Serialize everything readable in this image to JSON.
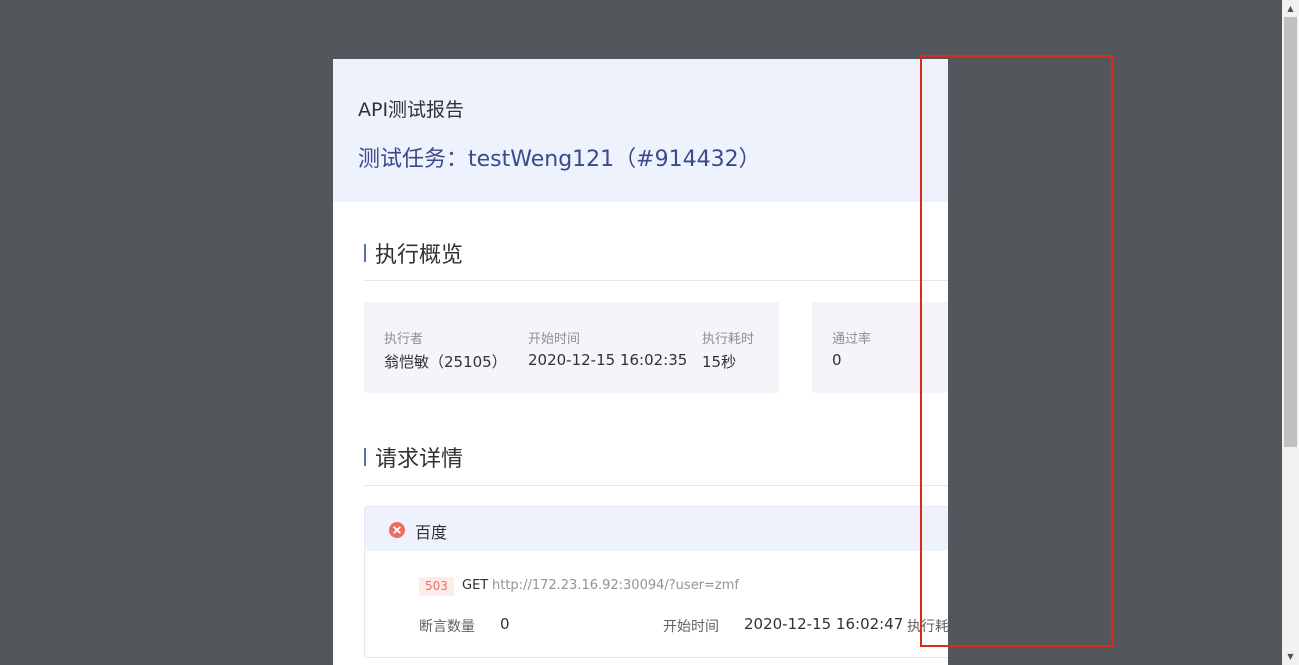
{
  "report": {
    "title": "API测试报告",
    "task_line": "测试任务：testWeng121（#914432）"
  },
  "overview": {
    "section_title": "执行概览",
    "executor_label": "执行者",
    "executor_value": "翁恺敏（25105）",
    "start_label": "开始时间",
    "start_value": "2020-12-15 16:02:35",
    "duration_label": "执行耗时",
    "duration_value": "15秒",
    "pass_rate_label": "通过率",
    "pass_rate_value": "0"
  },
  "requests": {
    "section_title": "请求详情",
    "items": [
      {
        "name": "百度",
        "status_icon": "error-circle-icon",
        "status_code": "503",
        "method": "GET",
        "url": "http://172.23.16.92:30094/?user=zmf",
        "assert_count_label": "断言数量",
        "assert_count_value": "0",
        "start_label": "开始时间",
        "start_value": "2020-12-15 16:02:47",
        "duration_label": "执行耗"
      }
    ]
  },
  "colors": {
    "background": "#53575b",
    "header_bg": "#eef2fd",
    "task_text": "#3b4a8c",
    "error": "#ef6a5f",
    "highlight": "#e0271e"
  }
}
